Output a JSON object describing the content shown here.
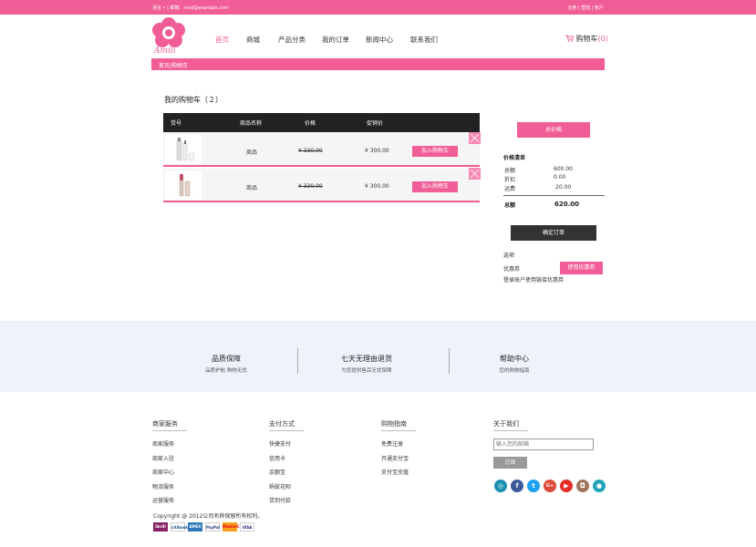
{
  "topbar": {
    "left": "语言 • | 邮箱：mail@example.com",
    "right": "注册 | 登陆 | 帐户"
  },
  "logo": {
    "text": "Amili"
  },
  "nav": [
    {
      "label": "首页"
    },
    {
      "label": "商城"
    },
    {
      "label": "产品分类"
    },
    {
      "label": "我的订单"
    },
    {
      "label": "新闻中心"
    },
    {
      "label": "联系我们"
    }
  ],
  "cart": {
    "label": "购物车",
    "count": "(0)"
  },
  "breadcrumb": "首页/购物车",
  "section_title": "我的购物车（２）",
  "table": {
    "headers": [
      "货号",
      "商品名称",
      "价格",
      "促销价"
    ],
    "rows": [
      {
        "name": "商品",
        "price": "¥ 330.00",
        "sale": "¥ 300.00",
        "button": "加入购物车"
      },
      {
        "name": "商品",
        "price": "¥ 330.00",
        "sale": "¥ 300.00",
        "button": "加入购物车"
      }
    ]
  },
  "summary": {
    "total_button": "总价格",
    "price_title": "价格清单",
    "lines": [
      {
        "label": "总额",
        "value": "600.00"
      },
      {
        "label": "折扣",
        "value": "0.00"
      },
      {
        "label": "运费",
        "value": "20.00"
      }
    ],
    "total_label": "总额",
    "total_value": "620.00",
    "confirm_button": "确定订单",
    "options_label": "选项",
    "coupon_label": "优惠券",
    "coupon_button": "使用优惠券",
    "login_note": "登录账户使用链接优惠券"
  },
  "guarantee": [
    {
      "title": "品质保障",
      "sub": "品质护航 购物无忧"
    },
    {
      "title": "七天无理由退货",
      "sub": "为您提供售后无忧保障"
    },
    {
      "title": "帮助中心",
      "sub": "您的购物指南"
    }
  ],
  "footer": {
    "columns": [
      {
        "heading": "商家服务",
        "items": [
          "商家服务",
          "商家入驻",
          "商家中心",
          "物流服务",
          "运营服务"
        ]
      },
      {
        "heading": "支付方式",
        "items": [
          "快捷支付",
          "信用卡",
          "余额宝",
          "蚂蚁花呗",
          "货到付款"
        ]
      },
      {
        "heading": "购物指南",
        "items": [
          "免费注册",
          "开通支付宝",
          "支付宝充值"
        ]
      },
      {
        "heading": "关于我们",
        "items": []
      }
    ],
    "email_placeholder": "输入您的邮箱",
    "subscribe": "订阅",
    "social_icons": [
      "dribbble-icon",
      "facebook-icon",
      "twitter-icon",
      "google-plus-icon",
      "youtube-icon",
      "instagram-icon",
      "location-icon"
    ],
    "copyright": "Copyright @ 2012公司名称保留所有权利。",
    "payments": [
      "Skrill",
      "citibank",
      "AMEX",
      "PayPal",
      "MasterCard",
      "VISA"
    ]
  },
  "colors": {
    "accent": "#f15d97",
    "dark": "#222222",
    "guarantee_bg": "#eef3fb"
  }
}
